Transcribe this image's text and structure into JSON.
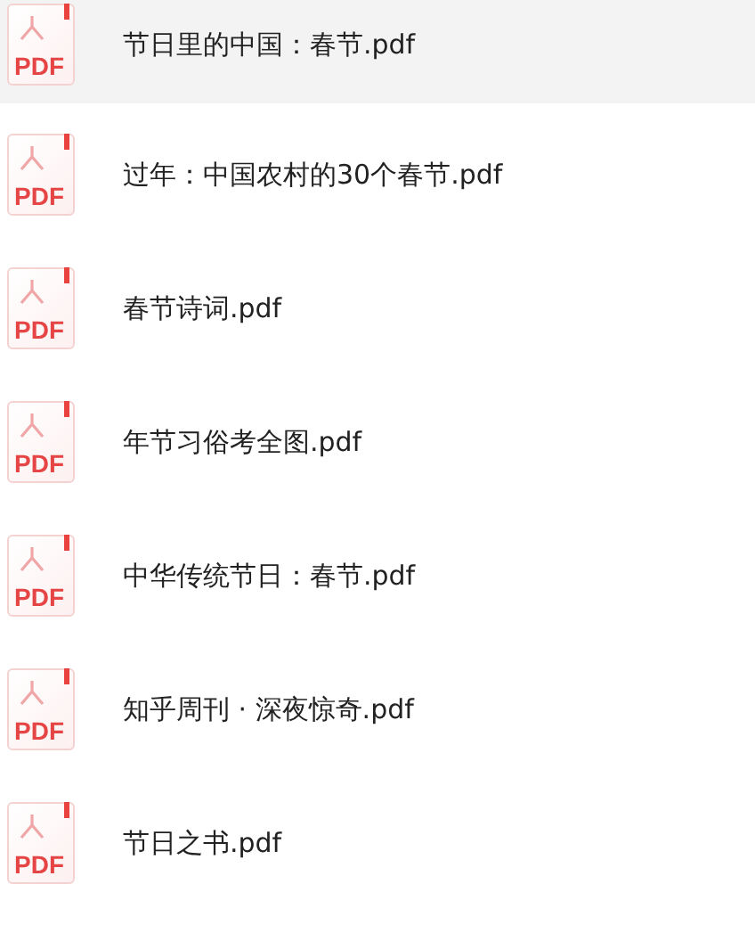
{
  "files": [
    {
      "name": "节日里的中国：春节.pdf",
      "icon_text": "PDF",
      "selected": true
    },
    {
      "name": "过年：中国农村的30个春节.pdf",
      "icon_text": "PDF",
      "selected": false
    },
    {
      "name": "春节诗词.pdf",
      "icon_text": "PDF",
      "selected": false
    },
    {
      "name": "年节习俗考全图.pdf",
      "icon_text": "PDF",
      "selected": false
    },
    {
      "name": "中华传统节日：春节.pdf",
      "icon_text": "PDF",
      "selected": false
    },
    {
      "name": "知乎周刊 · 深夜惊奇.pdf",
      "icon_text": "PDF",
      "selected": false
    },
    {
      "name": "节日之书.pdf",
      "icon_text": "PDF",
      "selected": false
    }
  ]
}
